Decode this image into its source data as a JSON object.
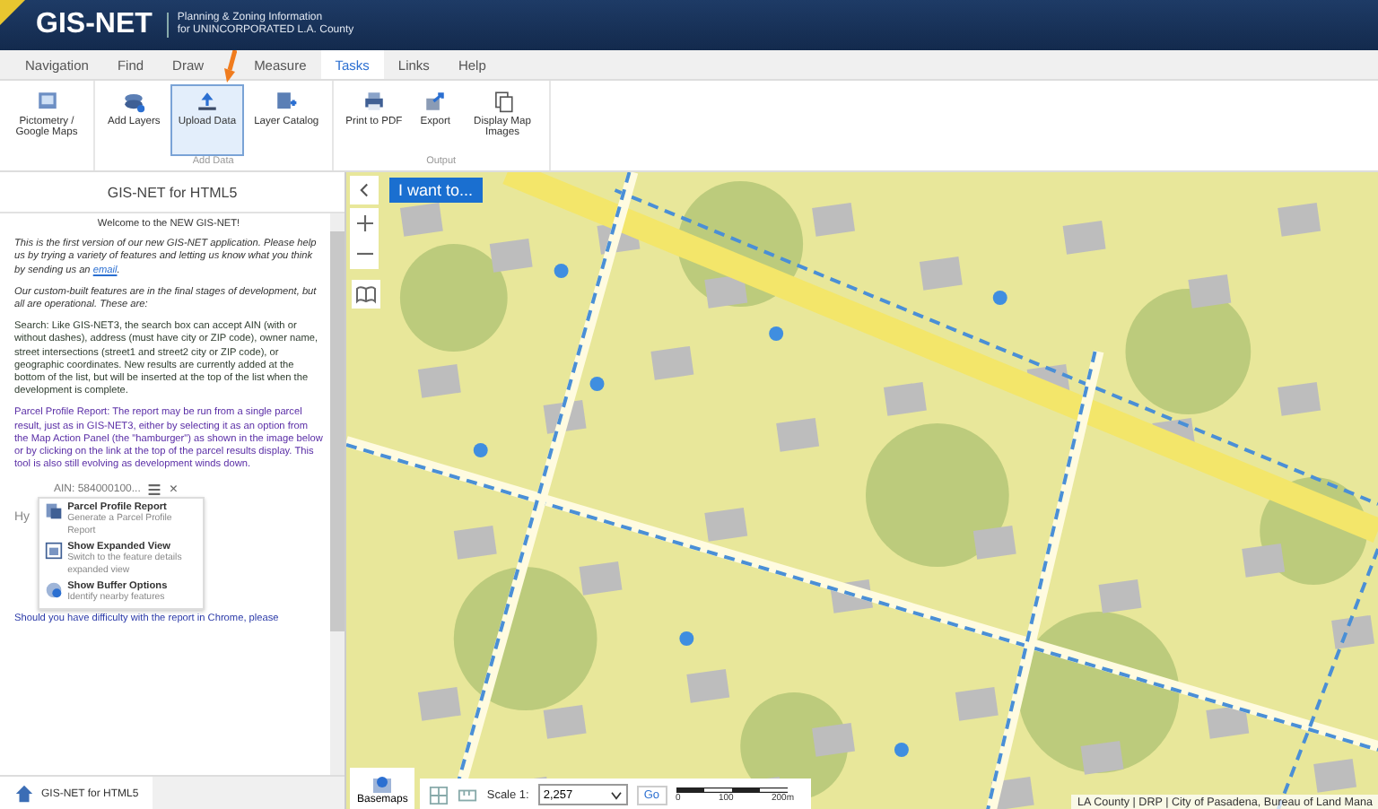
{
  "header": {
    "logo": "GIS-NET",
    "subtitle_1": "Planning & Zoning Information",
    "subtitle_2": "for UNINCORPORATED L.A. County"
  },
  "tabs": [
    {
      "label": "Navigation",
      "selected": false
    },
    {
      "label": "Find",
      "selected": false
    },
    {
      "label": "Draw",
      "selected": false
    },
    {
      "label": "Measure",
      "selected": false
    },
    {
      "label": "Tasks",
      "selected": true
    },
    {
      "label": "Links",
      "selected": false
    },
    {
      "label": "Help",
      "selected": false
    }
  ],
  "ribbon": [
    {
      "items": [
        {
          "label": "Pictometry / Google Maps",
          "kind": "photo",
          "selected": false
        }
      ]
    },
    {
      "label": "Add Data",
      "items": [
        {
          "label": "Add Layers",
          "kind": "layers",
          "selected": false
        },
        {
          "label": "Upload Data",
          "kind": "upload",
          "selected": true
        },
        {
          "label": "Layer Catalog",
          "kind": "catalog",
          "selected": false
        }
      ]
    },
    {
      "label": "Output",
      "items": [
        {
          "label": "Print to PDF",
          "kind": "print",
          "selected": false
        },
        {
          "label": "Export",
          "kind": "export",
          "selected": false
        },
        {
          "label": "Display Map Images",
          "kind": "images",
          "selected": false
        }
      ]
    }
  ],
  "panel": {
    "title": "GIS-NET for HTML5",
    "heading": "Welcome to the NEW GIS-NET!",
    "paragraphs": [
      {
        "kind": "italic",
        "text": "This is the first version of our new GIS-NET application. Please help us by trying a variety of features and letting us know what you think by sending us an ",
        "link": "email",
        "after": "."
      },
      {
        "kind": "italic",
        "text": "Our custom-built features are in the final stages of development, but all are operational. These are:"
      },
      {
        "kind": "plain",
        "text": "Search: Like GIS-NET3, the search box can accept AIN (with or without dashes), address (must have city or ZIP code), owner name, street intersections (street1 and street2 city or ZIP code), or geographic coordinates. New results are currently added at the bottom of the list, but will be inserted at the top of the list when the development is complete."
      },
      {
        "kind": "accent",
        "text": "Parcel Profile Report: The report may be run from a single parcel result, just as in GIS-NET3, either by selecting it as an option from the Map Action Panel (the \"hamburger\") as shown in the image below or by clicking on the link at the top of the parcel results display. This tool is also still evolving as development winds down."
      }
    ],
    "figure": {
      "ain": "AIN: 584000100...",
      "close": "×",
      "side_text": "Hy",
      "menu": [
        {
          "title": "Parcel Profile Report",
          "desc": "Generate a Parcel Profile Report",
          "kind": "report"
        },
        {
          "title": "Show Expanded View",
          "desc": "Switch to the feature details expanded view",
          "kind": "view"
        },
        {
          "title": "Show Buffer Options",
          "desc": "Identify nearby features",
          "kind": "buffer"
        }
      ]
    },
    "footer_text": "Should you have difficulty with the report in Chrome, please"
  },
  "map": {
    "want_button": "I want to...",
    "basemaps": "Basemaps",
    "scale_label": "Scale 1:",
    "scale_value": "2,257",
    "go": "Go",
    "scale_ticks": [
      "0",
      "100",
      "200m"
    ],
    "attribution": "LA County | DRP | City of Pasadena, Bureau of Land Mana"
  },
  "taskbar": {
    "label": "GIS-NET for HTML5"
  }
}
